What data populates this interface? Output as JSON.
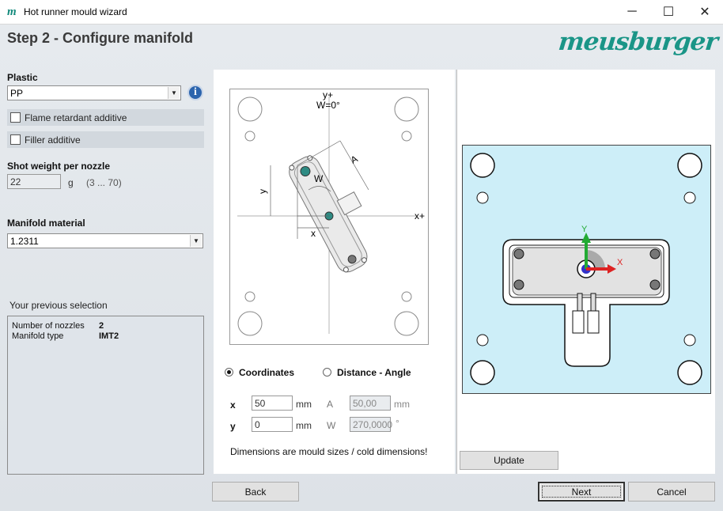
{
  "window": {
    "title": "Hot runner mould wizard",
    "minimize_glyph": "─",
    "maximize_glyph": "☐",
    "close_glyph": "✕"
  },
  "header": {
    "step_title": "Step 2 - Configure manifold",
    "logo_text": "meusburger"
  },
  "plastic": {
    "label": "Plastic",
    "value": "PP",
    "info_glyph": "i"
  },
  "additives": {
    "flame_retardant": "Flame retardant additive",
    "filler": "Filler additive"
  },
  "shot_weight": {
    "label": "Shot weight per nozzle",
    "value": "22",
    "unit": "g",
    "range": "(3 ... 70)"
  },
  "manifold_material": {
    "label": "Manifold material",
    "value": "1.2311"
  },
  "previous_selection": {
    "title": "Your previous selection",
    "rows": [
      {
        "key": "Number of nozzles",
        "value": "2"
      },
      {
        "key": "Manifold type",
        "value": "IMT2"
      }
    ]
  },
  "diagram": {
    "y_axis": "y+",
    "w_zero": "W=0°",
    "x_axis": "x+",
    "label_a": "A",
    "label_w": "W",
    "label_y": "y",
    "label_x": "x"
  },
  "mode": {
    "coordinates": "Coordinates",
    "distance_angle": "Distance - Angle"
  },
  "coords": {
    "x_label": "x",
    "x_value": "50",
    "x_unit": "mm",
    "y_label": "y",
    "y_value": "0",
    "y_unit": "mm",
    "a_label": "A",
    "a_value": "50,00",
    "a_unit": "mm",
    "w_label": "W",
    "w_value": "270,0000",
    "w_unit": "°"
  },
  "note": "Dimensions are mould sizes / cold dimensions!",
  "preview": {
    "y_axis": "Y",
    "x_axis": "X"
  },
  "buttons": {
    "update": "Update",
    "back": "Back",
    "next": "Next",
    "cancel": "Cancel"
  },
  "colors": {
    "accent": "#1a9587",
    "preview_bg": "#cdeef8",
    "info_blue": "#2b64ad"
  }
}
